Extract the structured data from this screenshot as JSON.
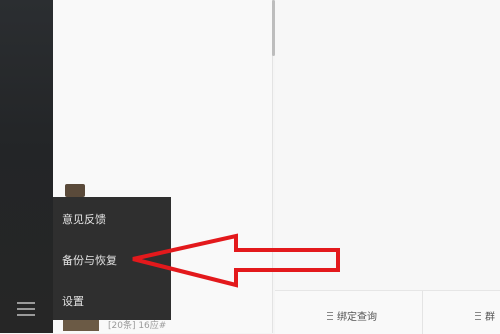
{
  "menu": {
    "items": [
      "意见反馈",
      "备份与恢复",
      "设置"
    ],
    "icon": "hamburger-icon"
  },
  "main": {
    "tabs": [
      {
        "label": "绑定查询",
        "icon": "list-icon"
      },
      {
        "label": "群",
        "icon": "list-icon"
      }
    ]
  },
  "chat_list": {
    "row_preview": "[20条] 16应#"
  },
  "annotation": {
    "arrow_color": "#e3191c"
  }
}
